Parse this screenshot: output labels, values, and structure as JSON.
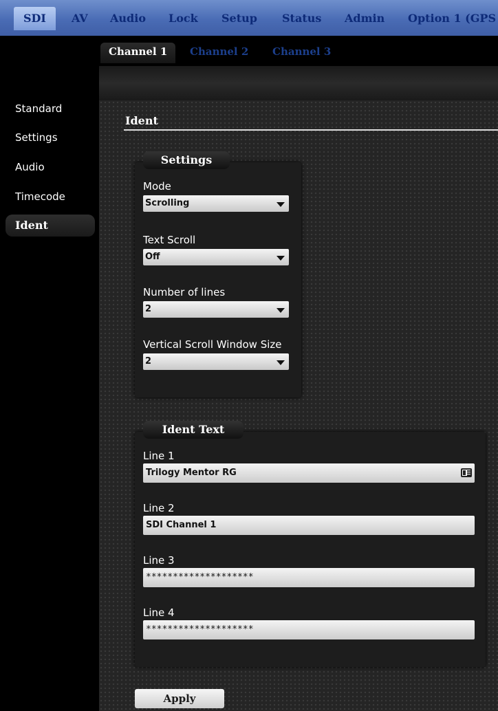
{
  "nav": {
    "tabs": [
      "SDI",
      "AV",
      "Audio",
      "Lock",
      "Setup",
      "Status",
      "Admin",
      "Option 1 (GPS"
    ]
  },
  "channels": [
    "Channel 1",
    "Channel 2",
    "Channel 3"
  ],
  "sidebar": {
    "items": [
      "Standard",
      "Settings",
      "Audio",
      "Timecode",
      "Ident"
    ]
  },
  "section": {
    "title": "Ident"
  },
  "settings": {
    "legend": "Settings",
    "mode": {
      "label": "Mode",
      "value": "Scrolling"
    },
    "text_scroll": {
      "label": "Text Scroll",
      "value": "Off"
    },
    "num_lines": {
      "label": "Number of lines",
      "value": "2"
    },
    "vscroll": {
      "label": "Vertical Scroll Window Size",
      "value": "2"
    }
  },
  "ident_text": {
    "legend": "Ident Text",
    "line1": {
      "label": "Line 1",
      "value": "Trilogy Mentor RG"
    },
    "line2": {
      "label": "Line 2",
      "value": "SDI Channel 1"
    },
    "line3": {
      "label": "Line 3",
      "value": "********************"
    },
    "line4": {
      "label": "Line 4",
      "value": "********************"
    }
  },
  "apply_label": "Apply",
  "icons": {
    "line1_field": "contact-card-icon",
    "dropdown": "chevron-down-icon"
  },
  "colors": {
    "nav_bg": "#4a6cb5",
    "nav_text": "#0d2a78",
    "content_bg": "#252525"
  }
}
